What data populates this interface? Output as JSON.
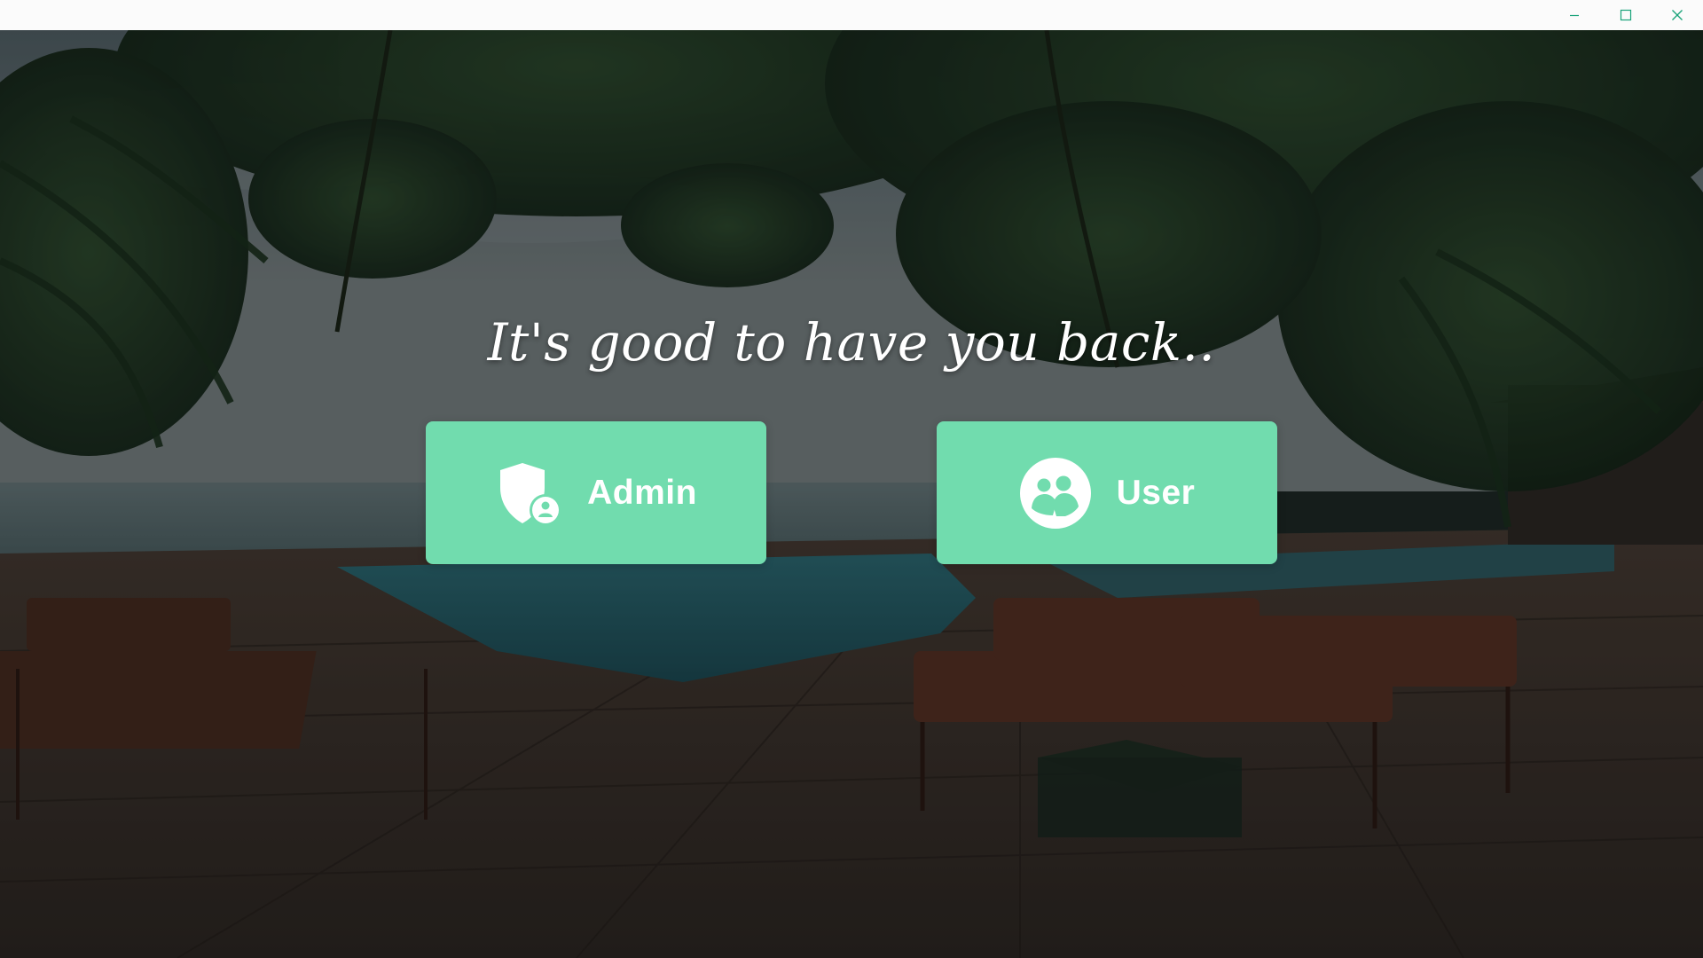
{
  "window": {
    "controls": {
      "minimize_icon": "minimize-icon",
      "maximize_icon": "maximize-icon",
      "close_icon": "close-icon"
    }
  },
  "greeting": "It's good to have you back..",
  "buttons": {
    "admin": {
      "label": "Admin",
      "icon": "admin-shield-icon"
    },
    "user": {
      "label": "User",
      "icon": "user-group-icon"
    }
  },
  "colors": {
    "button_bg": "#71dcae",
    "button_text": "#ffffff",
    "greeting_text": "#ffffff",
    "titlebar_bg": "#fbfbfb"
  }
}
